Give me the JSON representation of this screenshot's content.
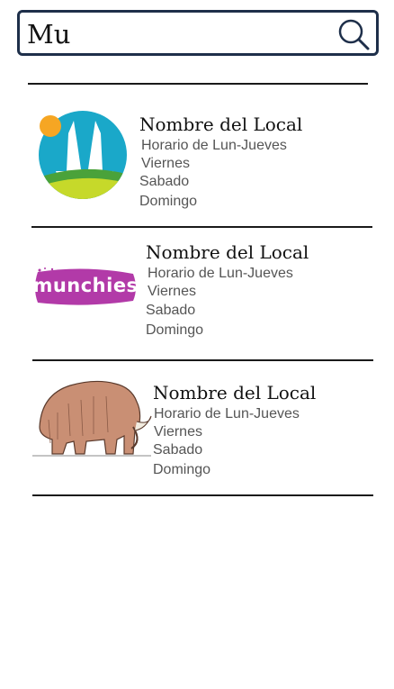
{
  "search": {
    "value": "Mu"
  },
  "results": [
    {
      "name": "Nombre del Local",
      "schedule": [
        "Horario de Lun-Jueves",
        "Viernes",
        "Sabado",
        "Domingo"
      ],
      "logo": "city-logo"
    },
    {
      "name": "Nombre del Local",
      "schedule": [
        "Horario de Lun-Jueves",
        "Viernes",
        "Sabado",
        "Domingo"
      ],
      "logo": "munchies-logo",
      "logo_text": "munchies"
    },
    {
      "name": "Nombre del Local",
      "schedule": [
        "Horario de Lun-Jueves",
        "Viernes",
        "Sabado",
        "Domingo"
      ],
      "logo": "mammoth-logo"
    }
  ],
  "colors": {
    "search_border": "#1e2f4a",
    "logo1_sky": "#1aa8c9",
    "logo1_sun": "#f6a623",
    "logo2_purple": "#b23aa8",
    "logo3_fur": "#c98f74"
  }
}
